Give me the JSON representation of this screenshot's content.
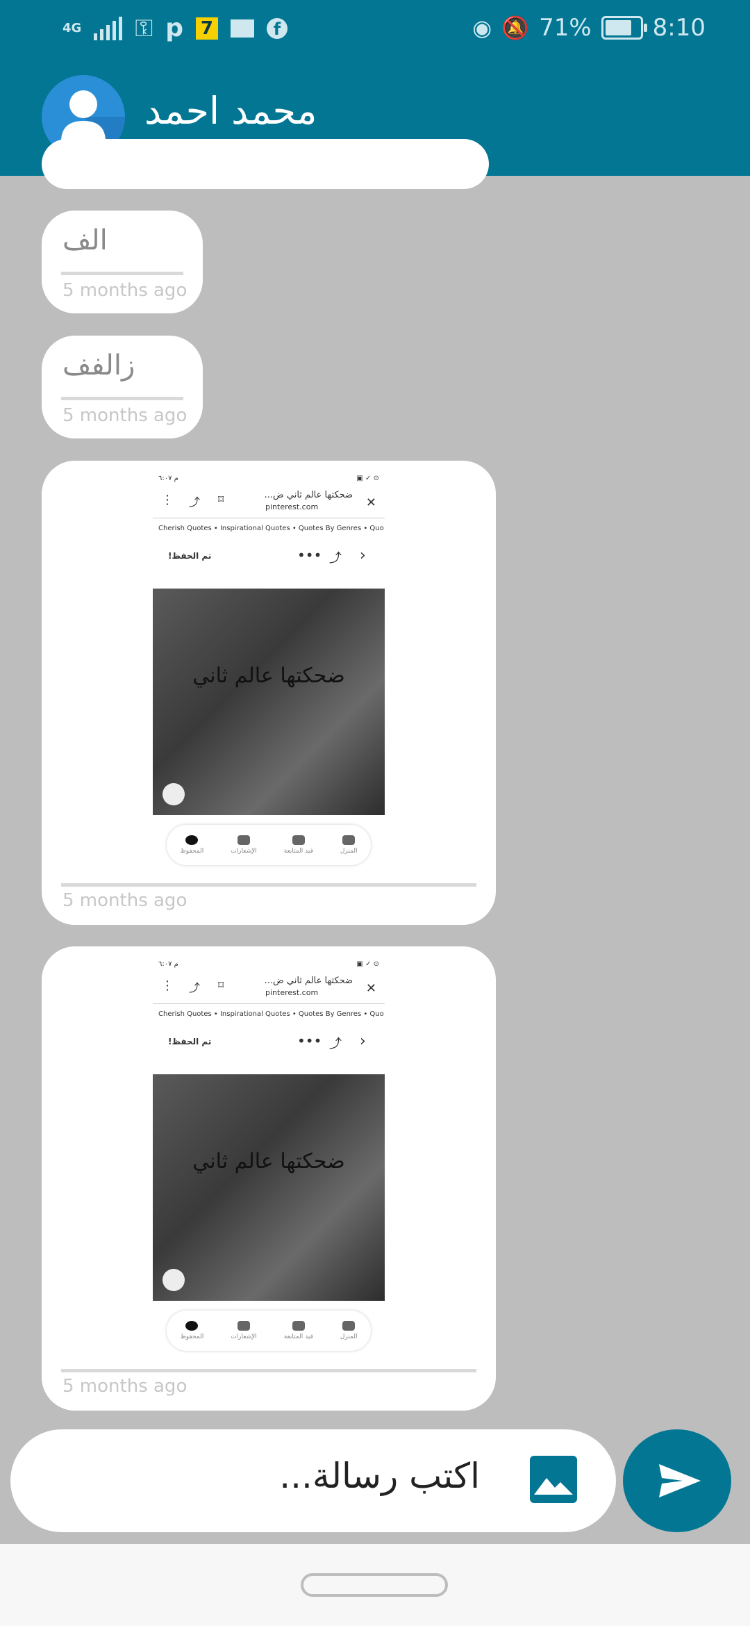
{
  "status_bar": {
    "network": "4G",
    "carrier_p": "p",
    "badge": "7",
    "battery": "71%",
    "time": "8:10"
  },
  "header": {
    "contact_name": "محمد احمد"
  },
  "messages": [
    {
      "type": "text",
      "text": "الف",
      "time": "5 months ago"
    },
    {
      "type": "text",
      "text": "زالفف",
      "time": "5 months ago"
    },
    {
      "type": "image",
      "time": "5 months ago",
      "shot": {
        "page_title": "ضحكتها عالم ثاني ض...",
        "domain": "pinterest.com",
        "crumbs": "Cherish Quotes • Inspirational Quotes • Quotes By Genres • Quo",
        "saved": "تم الحفظ!",
        "photo_text": "ضحكتها عالم ثاني",
        "nav": [
          "المحفوظ",
          "الإشعارات",
          "قيد المتابعة",
          "المنزل"
        ]
      }
    },
    {
      "type": "image",
      "time": "5 months ago",
      "shot": {
        "page_title": "ضحكتها عالم ثاني ض...",
        "domain": "pinterest.com",
        "crumbs": "Cherish Quotes • Inspirational Quotes • Quotes By Genres • Quo",
        "saved": "تم الحفظ!",
        "photo_text": "ضحكتها عالم ثاني",
        "nav": [
          "المحفوظ",
          "الإشعارات",
          "قيد المتابعة",
          "المنزل"
        ]
      }
    }
  ],
  "composer": {
    "placeholder": "اكتب رسالة..."
  },
  "colors": {
    "primary": "#027693",
    "chat_background": "#bdbdbd",
    "bubble": "#ffffff",
    "timestamp": "#c7c7c7"
  }
}
